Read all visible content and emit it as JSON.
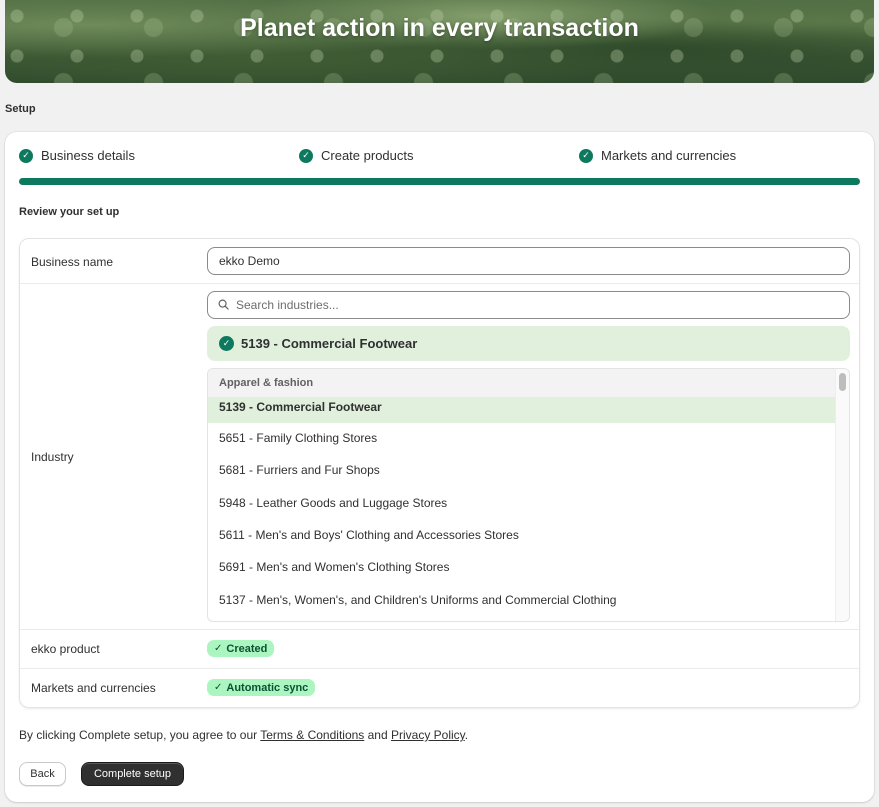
{
  "hero": {
    "title": "Planet action in every transaction"
  },
  "setup_label": "Setup",
  "steps": [
    {
      "label": "Business details"
    },
    {
      "label": "Create products"
    },
    {
      "label": "Markets and currencies"
    }
  ],
  "review_title": "Review your set up",
  "business": {
    "label": "Business name",
    "value": "ekko Demo"
  },
  "industry": {
    "label": "Industry",
    "search_placeholder": "Search industries...",
    "selected": "5139 - Commercial Footwear",
    "group": "Apparel & fashion",
    "options": [
      "5139 - Commercial Footwear",
      "5651 - Family Clothing Stores",
      "5681 - Furriers and Fur Shops",
      "5948 - Leather Goods and Luggage Stores",
      "5611 - Men's and Boys' Clothing and Accessories Stores",
      "5691 - Men's and Women's Clothing Stores",
      "5137 - Men's, Women's, and Children's Uniforms and Commercial Clothing"
    ]
  },
  "product": {
    "label": "ekko product",
    "badge": "Created"
  },
  "markets": {
    "label": "Markets and currencies",
    "badge": "Automatic sync"
  },
  "terms": {
    "prefix": "By clicking Complete setup, you agree to our ",
    "terms_link": "Terms & Conditions",
    "middle": " and ",
    "privacy_link": "Privacy Policy",
    "suffix": "."
  },
  "buttons": {
    "back": "Back",
    "complete": "Complete setup"
  },
  "colors": {
    "accent": "#0d7a5f",
    "badge_bg": "#abf5c1",
    "selected_bg": "#e1f0dc"
  }
}
